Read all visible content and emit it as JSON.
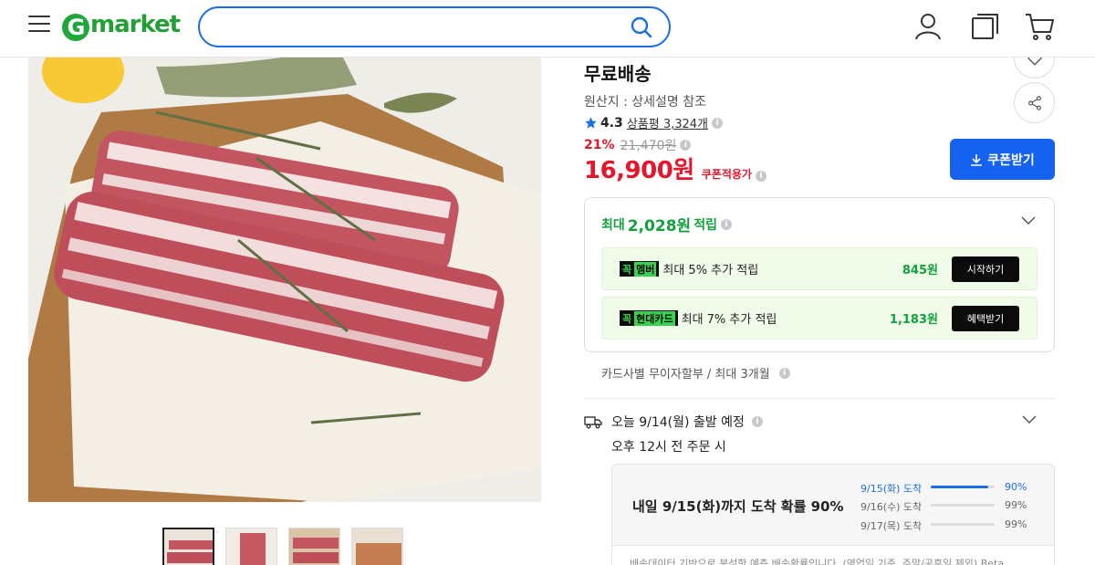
{
  "header": {
    "logo": "market",
    "logo_letter": "G",
    "search_placeholder": ""
  },
  "product": {
    "title": "무료배송",
    "origin": "원산지 : 상세설명 참조",
    "rating_score": "4.3",
    "rating_count": "상품평 3,324개",
    "discount_pct": "21%",
    "original_price": "21,470원",
    "price": "16,900원",
    "coupon_applied": "쿠폰적용가",
    "coupon_button": "쿠폰받기"
  },
  "rewards": {
    "head_prefix": "최대",
    "head_amount": "2,028원",
    "head_suffix": "적립",
    "items": [
      {
        "badge": "꼭",
        "badge_hl": "멤버",
        "text": "최대 5% 추가 적립",
        "amount": "845원",
        "button": "시작하기"
      },
      {
        "badge": "꼭",
        "badge_hl": "현대카드",
        "text": "최대 7% 추가 적립",
        "amount": "1,183원",
        "button": "혜택받기"
      }
    ]
  },
  "installment": "카드사별 무이자할부 / 최대 3개월",
  "shipping": {
    "line1": "오늘 9/14(월) 출발 예정",
    "line2": "오후 12시 전 주문 시",
    "box_title": "내일 9/15(화)까지 도착 확률 90%",
    "rows": [
      {
        "label": "9/15(화) 도착",
        "pct": "90%",
        "value": 0.9
      },
      {
        "label": "9/16(수) 도착",
        "pct": "99%",
        "value": 0.99
      },
      {
        "label": "9/17(목) 도착",
        "pct": "99%",
        "value": 0.99
      }
    ],
    "note": "배송데이터 기반으로 분석한 예측 배송확률입니다. (영업일 기준, 주말/공휴일 제외) Beta"
  },
  "colors": {
    "brand_green": "#22a036",
    "price_red": "#e4162b",
    "action_blue": "#1562f0",
    "reward_green": "#13a13d"
  }
}
